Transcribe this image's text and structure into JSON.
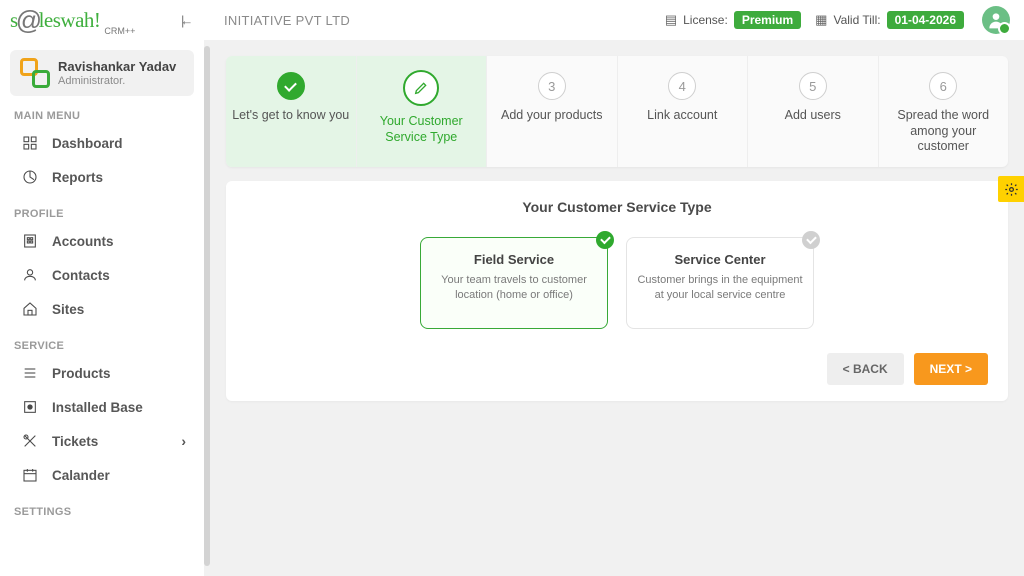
{
  "header": {
    "company": "INITIATIVE PVT LTD",
    "license_label": "License:",
    "license_value": "Premium",
    "valid_label": "Valid Till:",
    "valid_value": "01-04-2026"
  },
  "user": {
    "name": "Ravishankar Yadav",
    "role": "Administrator."
  },
  "sidebar": {
    "sections": {
      "main": "MAIN MENU",
      "profile": "PROFILE",
      "service": "SERVICE",
      "settings": "SETTINGS"
    },
    "items": {
      "dashboard": "Dashboard",
      "reports": "Reports",
      "accounts": "Accounts",
      "contacts": "Contacts",
      "sites": "Sites",
      "products": "Products",
      "installed_base": "Installed Base",
      "tickets": "Tickets",
      "calander": "Calander"
    }
  },
  "stepper": {
    "steps": [
      {
        "label": "Let's get to know you"
      },
      {
        "label": "Your Customer Service Type"
      },
      {
        "num": "3",
        "label": "Add your products"
      },
      {
        "num": "4",
        "label": "Link account"
      },
      {
        "num": "5",
        "label": "Add users"
      },
      {
        "num": "6",
        "label": "Spread the word among your customer"
      }
    ]
  },
  "content": {
    "title": "Your Customer Service Type",
    "options": [
      {
        "title": "Field Service",
        "desc": "Your team travels to customer location (home or office)"
      },
      {
        "title": "Service Center",
        "desc": "Customer brings in the equipment at your local service centre"
      }
    ],
    "back_label": "< BACK",
    "next_label": "NEXT >"
  }
}
